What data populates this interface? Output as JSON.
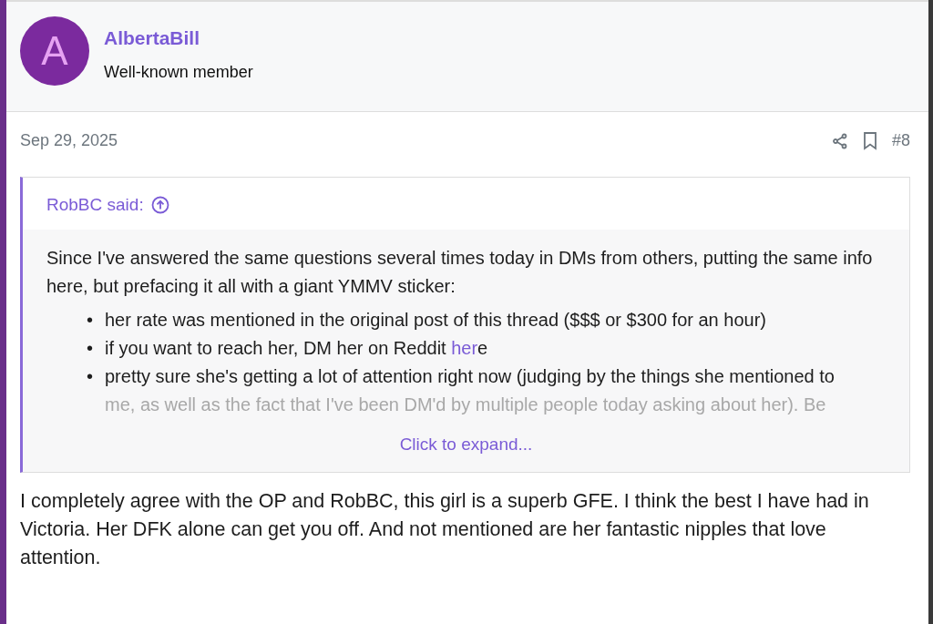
{
  "author": {
    "avatar_letter": "A",
    "name": "AlbertaBill",
    "title": "Well-known member"
  },
  "post": {
    "date": "Sep 29, 2025",
    "number": "#8"
  },
  "quote": {
    "attribution": "RobBC said:",
    "intro": "Since I've answered the same questions several times today in DMs from others, putting the same info here, but prefacing it all with a giant YMMV sticker:",
    "items": [
      {
        "marker": "•",
        "text": "her rate was mentioned in the original post of this thread ($$$ or $300 for an hour)"
      },
      {
        "marker": "•",
        "text": "if you want to reach her, DM her on Reddit ",
        "link": "her",
        "tail": "e"
      },
      {
        "marker": "•",
        "text": "pretty sure she's getting a lot of attention right now (judging by the things she mentioned to",
        "faded": "me, as well as the fact that I've been DM'd by multiple people today asking about her). Be"
      }
    ],
    "expand": "Click to expand..."
  },
  "body": "I completely agree with the OP and RobBC, this girl is a superb GFE. I think the best I have had in Victoria. Her DFK alone can get you off. And not mentioned are her fantastic nipples that love attention."
}
